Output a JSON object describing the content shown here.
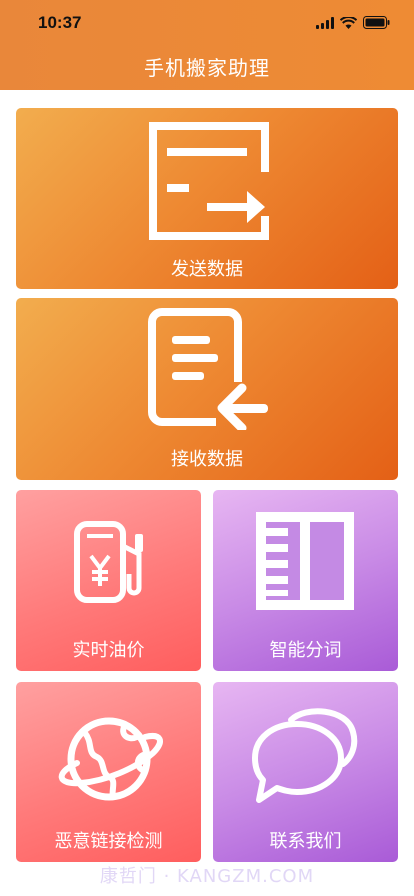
{
  "status_bar": {
    "time": "10:37"
  },
  "nav": {
    "title": "手机搬家助理"
  },
  "cards": {
    "send": {
      "label": "发送数据",
      "icon": "send-data-icon"
    },
    "receive": {
      "label": "接收数据",
      "icon": "receive-data-icon"
    },
    "oil": {
      "label": "实时油价",
      "icon": "fuel-pump-icon"
    },
    "segment": {
      "label": "智能分词",
      "icon": "word-segment-icon"
    },
    "link_check": {
      "label": "恶意链接检测",
      "icon": "globe-planet-icon"
    },
    "contact": {
      "label": "联系我们",
      "icon": "chat-bubbles-icon"
    }
  },
  "watermark": "康哲门 · KANGZM.COM",
  "colors": {
    "header": "#ee8b34",
    "orange_card": "#ee8a33",
    "red_card": "#ff7a7a",
    "purple_card": "#c98be6"
  }
}
